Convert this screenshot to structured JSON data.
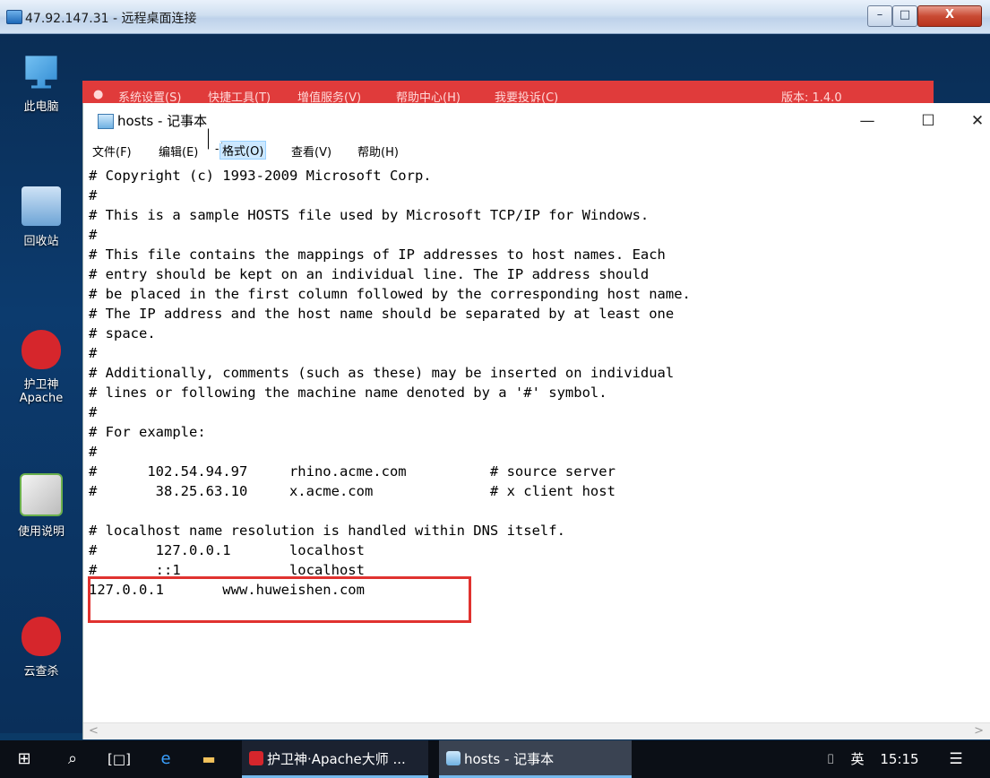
{
  "rdp": {
    "title": "47.92.147.31 - 远程桌面连接",
    "min_label": "–",
    "max_label": "□",
    "close_label": "X"
  },
  "desktop_icons": [
    {
      "label": "此电脑"
    },
    {
      "label": "回收站"
    },
    {
      "label": "护卫神"
    },
    {
      "label": "Apache"
    },
    {
      "label": "使用说明"
    },
    {
      "label": "云查杀"
    }
  ],
  "redapp": {
    "menu": [
      "系统设置(S)",
      "快捷工具(T)",
      "增值服务(V)",
      "帮助中心(H)",
      "我要投诉(C)"
    ],
    "version": "版本: 1.4.0"
  },
  "notepad": {
    "title": "hosts - 记事本",
    "min": "—",
    "max": "☐",
    "close": "✕",
    "menu": [
      "文件(F)",
      "编辑(E)",
      "格式(O)",
      "查看(V)",
      "帮助(H)"
    ],
    "lines": [
      "# Copyright (c) 1993-2009 Microsoft Corp.",
      "#",
      "# This is a sample HOSTS file used by Microsoft TCP/IP for Windows.",
      "#",
      "# This file contains the mappings of IP addresses to host names. Each",
      "# entry should be kept on an individual line. The IP address should",
      "# be placed in the first column followed by the corresponding host name.",
      "# The IP address and the host name should be separated by at least one",
      "# space.",
      "#",
      "# Additionally, comments (such as these) may be inserted on individual",
      "# lines or following the machine name denoted by a '#' symbol.",
      "#",
      "# For example:",
      "#",
      "#      102.54.94.97     rhino.acme.com          # source server",
      "#       38.25.63.10     x.acme.com              # x client host",
      "",
      "# localhost name resolution is handled within DNS itself.",
      "#\t127.0.0.1       localhost",
      "#\t::1             localhost",
      "127.0.0.1       www.huweishen.com"
    ],
    "scroll_left": "<",
    "scroll_right": ">"
  },
  "taskbar": {
    "items": [
      "护卫神·Apache大师 ...",
      "hosts - 记事本"
    ],
    "ime": "英",
    "time": "15:15"
  }
}
